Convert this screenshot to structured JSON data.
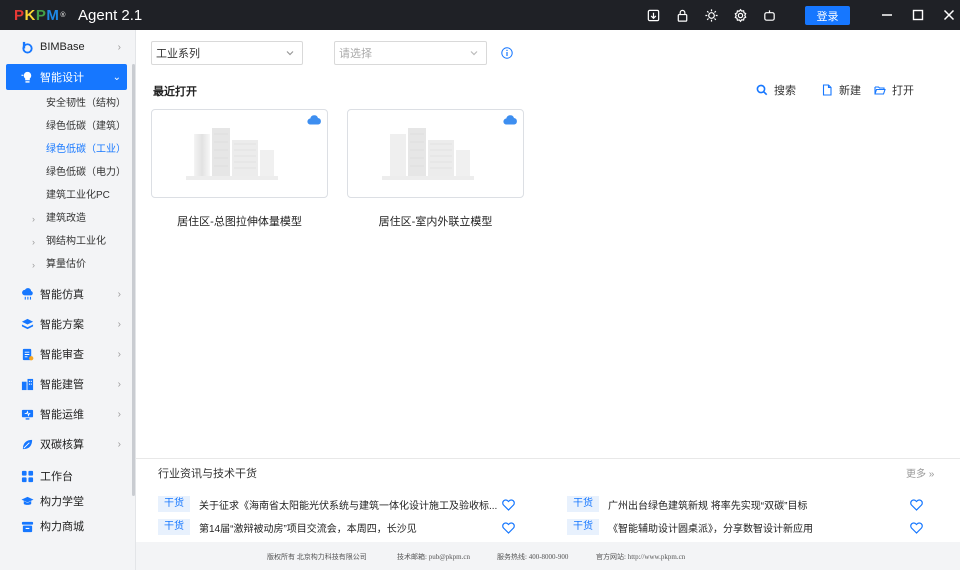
{
  "titlebar": {
    "logo_letters": [
      "P",
      "K",
      "P",
      "M"
    ],
    "logo_mark": "®",
    "app_name": "Agent 2.1",
    "icons": [
      "import-icon",
      "lock-icon",
      "brightness-icon",
      "settings-icon",
      "robot-icon"
    ],
    "login_label": "登录",
    "accent": "#1677ff"
  },
  "sidebar": {
    "top_items": [
      {
        "label": "BIMBase",
        "icon": "bimbase-icon"
      },
      {
        "label": "智能设计",
        "icon": "bulb-icon"
      },
      {
        "label": "智能仿真",
        "icon": "cloud-rain-icon"
      },
      {
        "label": "智能方案",
        "icon": "layers-icon"
      },
      {
        "label": "智能审查",
        "icon": "doc-check-icon"
      },
      {
        "label": "智能建管",
        "icon": "building-icon"
      },
      {
        "label": "智能运维",
        "icon": "monitor-icon"
      },
      {
        "label": "双碳核算",
        "icon": "leaf-icon"
      }
    ],
    "design_subitems": [
      "安全韧性（结构）",
      "绿色低碳（建筑）",
      "绿色低碳（工业）",
      "绿色低碳（电力）",
      "建筑工业化PC"
    ],
    "design_subgroups": [
      "建筑改造",
      "钢结构工业化",
      "算量估价"
    ],
    "bottom_items": [
      {
        "label": "工作台",
        "icon": "grid-icon"
      },
      {
        "label": "构力学堂",
        "icon": "graduation-icon"
      },
      {
        "label": "构力商城",
        "icon": "store-icon"
      }
    ]
  },
  "main": {
    "series_select": "工业系列",
    "second_select_placeholder": "请选择",
    "recent_title": "最近打开",
    "actions": {
      "search": "搜索",
      "new": "新建",
      "open": "打开"
    },
    "cards": [
      {
        "label": "居住区-总图拉伸体量模型"
      },
      {
        "label": "居住区-室内外联立模型"
      }
    ]
  },
  "news": {
    "title": "行业资讯与技术干货",
    "more": "更多 »",
    "tag": "干货",
    "items": [
      "关于征求《海南省太阳能光伏系统与建筑一体化设计施工及验收标...",
      "广州出台绿色建筑新规 将率先实现“双碳”目标",
      "第14届“激辩被动房”项目交流会，本周四，长沙见",
      "《智能辅助设计圆桌派》，分享数智设计新应用"
    ]
  },
  "footer": {
    "copyright": "版权所有 北京构力科技有限公司",
    "email": "技术邮箱: pub@pkpm.cn",
    "hotline": "服务热线: 400-8000-900",
    "website": "官方网站: http://www.pkpm.cn"
  }
}
